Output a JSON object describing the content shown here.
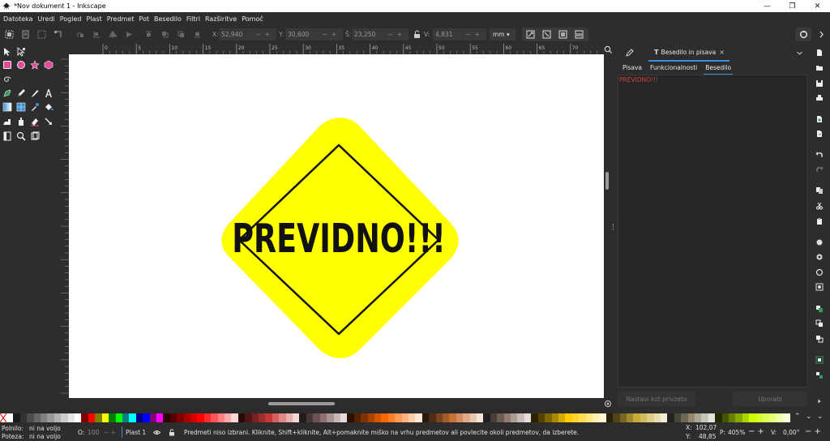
{
  "window": {
    "title": "*Nov dokument 1 - Inkscape",
    "minimize": "—",
    "maximize": "❐",
    "close": "✕"
  },
  "menu": [
    "Datoteka",
    "Uredi",
    "Pogled",
    "Plast",
    "Predmet",
    "Pot",
    "Besedilo",
    "Filtri",
    "Razširitve",
    "Pomoč"
  ],
  "toolcontrols": {
    "x_label": "X:",
    "x_value": "52,940",
    "y_label": "Y:",
    "y_value": "30,600",
    "w_label": "Š:",
    "w_value": "23,250",
    "h_label": "V:",
    "h_value": "4,831",
    "unit": "mm"
  },
  "ruler": {
    "ticks": [
      "0",
      "5",
      "10",
      "15",
      "20",
      "25",
      "30",
      "35",
      "40",
      "45",
      "50",
      "55",
      "60",
      "65",
      "70",
      "75",
      "80",
      "85",
      "90",
      "95",
      "100"
    ]
  },
  "canvas": {
    "sign_text": "PREVIDNO!!!",
    "sign_fill": "#ffff00",
    "sign_border": "#111111"
  },
  "dock": {
    "tab_title": "Besedilo in pisava",
    "subtabs": [
      "Pisava",
      "Funkcionalnosti",
      "Besedilo"
    ],
    "active_subtab": "Besedilo",
    "text_content": "PREVIDNO!!!",
    "set_default_label": "Nastavi kot privzeto",
    "apply_label": "Uporabi"
  },
  "status": {
    "fill_label": "Polnilo:",
    "fill_value": "ni na voljo",
    "stroke_label": "Poteza:",
    "stroke_value": "ni na voljo",
    "opacity_label": "O:",
    "opacity_value": "100",
    "layer": "Plast 1",
    "message": "Predmeti niso izbrani. Kliknite, Shift+kliknite, Alt+pomaknite miško na vrhu predmetov ali povlecite okoli predmetov, da izberete.",
    "x_label": "X:",
    "x_value": "102,07",
    "y_label": "Y:",
    "y_value": "48,85",
    "zoom_label": "P:",
    "zoom_value": "405%",
    "rotation_label": "V:",
    "rotation_value": "0,00°"
  },
  "palette_colors": [
    "#ffffff",
    "#1a1a1a",
    "#333333",
    "#4d4d4d",
    "#666666",
    "#808080",
    "#999999",
    "#b3b3b3",
    "#cccccc",
    "#e6e6e6",
    "#ffffff",
    "#800000",
    "#ff0000",
    "#808000",
    "#ffff00",
    "#008000",
    "#00ff00",
    "#008080",
    "#00ffff",
    "#000080",
    "#0000ff",
    "#800080",
    "#ff00ff",
    "#2b0000",
    "#550000",
    "#800000",
    "#aa0000",
    "#d40000",
    "#ff0000",
    "#ff2a2a",
    "#ff5555",
    "#ff8080",
    "#ffaaaa",
    "#ffd5d5",
    "#280b0b",
    "#501616",
    "#782121",
    "#a02c2c",
    "#c83737",
    "#d35f5f",
    "#de8787",
    "#e9afaf",
    "#f4d7d7",
    "#241c1c",
    "#483737",
    "#6c5353",
    "#916f6f",
    "#ac9393",
    "#c8b7b7",
    "#e3dbdb",
    "#2b1100",
    "#552200",
    "#803300",
    "#aa4400",
    "#d45500",
    "#ff6600",
    "#ff7f2a",
    "#ff9955",
    "#ffb380",
    "#ffccaa",
    "#ffe6d5",
    "#28170b",
    "#502d16",
    "#784421",
    "#a05a2c",
    "#c87137",
    "#d38d5f",
    "#deaa87",
    "#e9c6af",
    "#f4e3d7",
    "#241f1c",
    "#483e37",
    "#6c5d53",
    "#917c6f",
    "#ac9d93",
    "#c8beb7",
    "#e3dedb",
    "#2b2200",
    "#554400",
    "#806600",
    "#aa8800",
    "#d4aa00",
    "#ffcc00",
    "#ffd42a",
    "#ffdd55",
    "#ffe680",
    "#ffeeaa",
    "#fff6d5",
    "#28220b",
    "#504416",
    "#786721",
    "#a0892c",
    "#c8ab37",
    "#d3bc5f",
    "#decd87",
    "#e9ddaf",
    "#f4eed7",
    "#24221c",
    "#484537",
    "#6c6753",
    "#918a6f",
    "#aca793",
    "#c8c4b7",
    "#e3e2db",
    "#222b00",
    "#445500",
    "#668000",
    "#88aa00",
    "#aad400",
    "#ccff00",
    "#d4ff2a",
    "#ddff55",
    "#e5ff80",
    "#eeffaa",
    "#f6ffd5"
  ],
  "colors": {
    "accent": "#3a8fd6",
    "canvas_bg": "#ffffff",
    "panel_bg": "#2d2d2d"
  }
}
